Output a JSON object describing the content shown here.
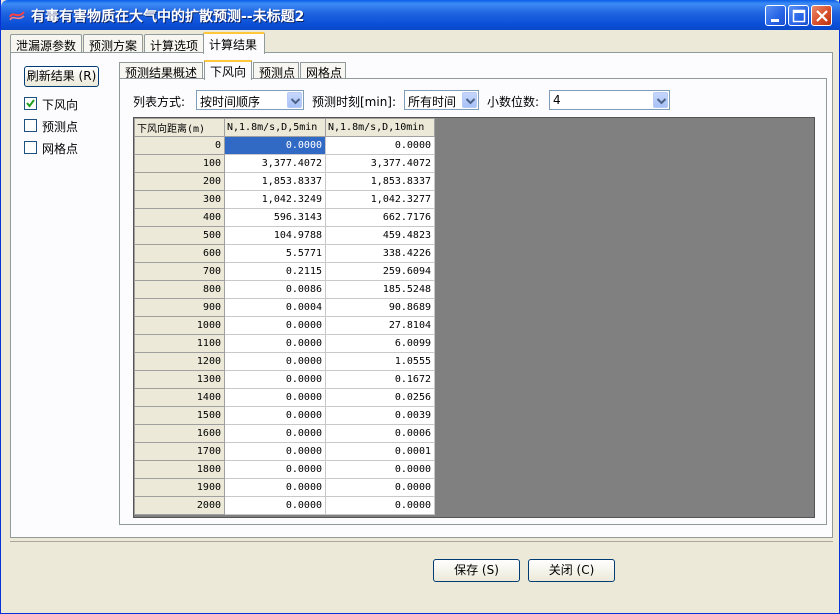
{
  "window": {
    "title": "有毒有害物质在大气中的扩散预测--未标题2"
  },
  "tabs": [
    {
      "label": "泄漏源参数"
    },
    {
      "label": "预测方案"
    },
    {
      "label": "计算选项"
    },
    {
      "label": "计算结果"
    }
  ],
  "sidebar": {
    "refresh_label": "刷新结果 (R)",
    "checks": [
      {
        "label": "下风向",
        "checked": true
      },
      {
        "label": "预测点",
        "checked": false
      },
      {
        "label": "网格点",
        "checked": false
      }
    ]
  },
  "subtabs": [
    {
      "label": "预测结果概述"
    },
    {
      "label": "下风向"
    },
    {
      "label": "预测点"
    },
    {
      "label": "网格点"
    }
  ],
  "options": {
    "list_mode_label": "列表方式:",
    "list_mode_value": "按时间顺序",
    "time_label": "预测时刻[min]:",
    "time_value": "所有时间",
    "decimals_label": "小数位数:",
    "decimals_value": "4"
  },
  "table": {
    "headers": [
      "下风向距离(m)",
      "N,1.8m/s,D,5min",
      "N,1.8m/s,D,10min"
    ],
    "rows": [
      [
        "0",
        "0.0000",
        "0.0000"
      ],
      [
        "100",
        "3,377.4072",
        "3,377.4072"
      ],
      [
        "200",
        "1,853.8337",
        "1,853.8337"
      ],
      [
        "300",
        "1,042.3249",
        "1,042.3277"
      ],
      [
        "400",
        "596.3143",
        "662.7176"
      ],
      [
        "500",
        "104.9788",
        "459.4823"
      ],
      [
        "600",
        "5.5771",
        "338.4226"
      ],
      [
        "700",
        "0.2115",
        "259.6094"
      ],
      [
        "800",
        "0.0086",
        "185.5248"
      ],
      [
        "900",
        "0.0004",
        "90.8689"
      ],
      [
        "1000",
        "0.0000",
        "27.8104"
      ],
      [
        "1100",
        "0.0000",
        "6.0099"
      ],
      [
        "1200",
        "0.0000",
        "1.0555"
      ],
      [
        "1300",
        "0.0000",
        "0.1672"
      ],
      [
        "1400",
        "0.0000",
        "0.0256"
      ],
      [
        "1500",
        "0.0000",
        "0.0039"
      ],
      [
        "1600",
        "0.0000",
        "0.0006"
      ],
      [
        "1700",
        "0.0000",
        "0.0001"
      ],
      [
        "1800",
        "0.0000",
        "0.0000"
      ],
      [
        "1900",
        "0.0000",
        "0.0000"
      ],
      [
        "2000",
        "0.0000",
        "0.0000"
      ]
    ]
  },
  "footer": {
    "save_label": "保存 (S)",
    "close_label": "关闭 (C)"
  },
  "colors": {
    "title_bar": "#0b4fd8",
    "selection": "#316ac5",
    "grid_background": "#808080",
    "active_tab_accent": "#ffc83c"
  }
}
